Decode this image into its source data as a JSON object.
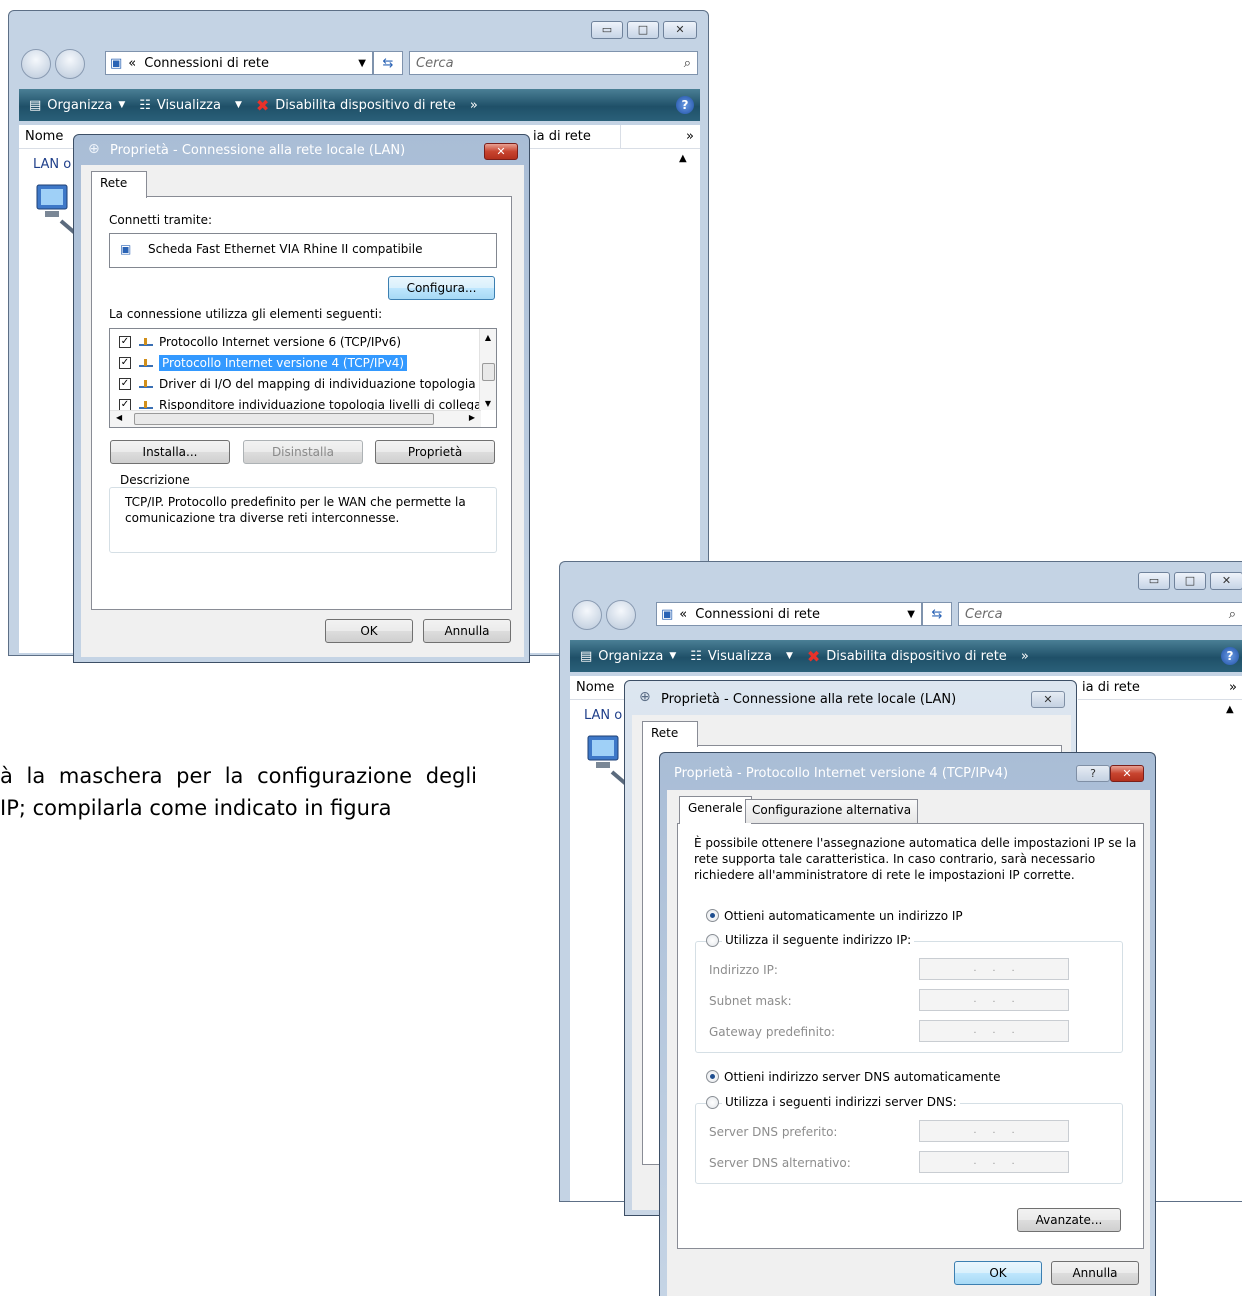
{
  "explorer1": {
    "address": "Connessioni di rete",
    "search_placeholder": "Cerca",
    "toolbar": {
      "organize": "Organizza",
      "view": "Visualizza",
      "disable": "Disabilita dispositivo di rete",
      "more": "»"
    },
    "columns": {
      "name": "Nome",
      "category": "ia di rete",
      "more": "»"
    },
    "item_label": "LAN o"
  },
  "explorer2": {
    "address": "Connessioni di rete",
    "search_placeholder": "Cerca",
    "toolbar": {
      "organize": "Organizza",
      "view": "Visualizza",
      "disable": "Disabilita dispositivo di rete",
      "more": "»"
    },
    "columns": {
      "name": "Nome",
      "category": "ia di rete",
      "more": "»"
    },
    "item_label": "LAN o"
  },
  "lan_dialog": {
    "title": "Proprietà - Connessione alla rete locale (LAN)",
    "tab": "Rete",
    "connect_via_label": "Connetti tramite:",
    "adapter": "Scheda Fast Ethernet VIA Rhine II compatibile",
    "configure_button": "Configura...",
    "items_label": "La connessione utilizza gli elementi seguenti:",
    "items": [
      "Protocollo Internet versione 6 (TCP/IPv6)",
      "Protocollo Internet versione 4 (TCP/IPv4)",
      "Driver di I/O del mapping di individuazione topologia liv",
      "Risponditore individuazione topologia livelli di collegam"
    ],
    "install_button": "Installa...",
    "uninstall_button": "Disinstalla",
    "properties_button": "Proprietà",
    "description_label": "Descrizione",
    "description_text_1": "TCP/IP. Protocollo predefinito per le WAN che permette la",
    "description_text_2": "comunicazione tra diverse reti interconnesse.",
    "ok_button": "OK",
    "cancel_button": "Annulla"
  },
  "lan_dialog_back": {
    "title": "Proprietà - Connessione alla rete locale (LAN)",
    "tab": "Rete"
  },
  "ipv4_dialog": {
    "title": "Proprietà - Protocollo Internet versione 4 (TCP/IPv4)",
    "tabs": [
      "Generale",
      "Configurazione alternativa"
    ],
    "intro_1": "È possibile ottenere l'assegnazione automatica delle impostazioni IP se la",
    "intro_2": "rete supporta tale caratteristica. In caso contrario, sarà necessario",
    "intro_3": "richiedere all'amministratore di rete le impostazioni IP corrette.",
    "auto_ip": "Ottieni automaticamente un indirizzo IP",
    "manual_ip": "Utilizza il seguente indirizzo IP:",
    "ip_label": "Indirizzo IP:",
    "mask_label": "Subnet mask:",
    "gateway_label": "Gateway predefinito:",
    "auto_dns": "Ottieni indirizzo server DNS automaticamente",
    "manual_dns": "Utilizza i seguenti indirizzi server DNS:",
    "dns1_label": "Server DNS preferito:",
    "dns2_label": "Server DNS alternativo:",
    "ip_placeholder": ".     .     .",
    "advanced_button": "Avanzate...",
    "ok_button": "OK",
    "cancel_button": "Annulla",
    "help_button": "?"
  },
  "caption": {
    "line1": "à la maschera per la configurazione degli",
    "line2": "IP; compilarla come indicato in figura"
  }
}
